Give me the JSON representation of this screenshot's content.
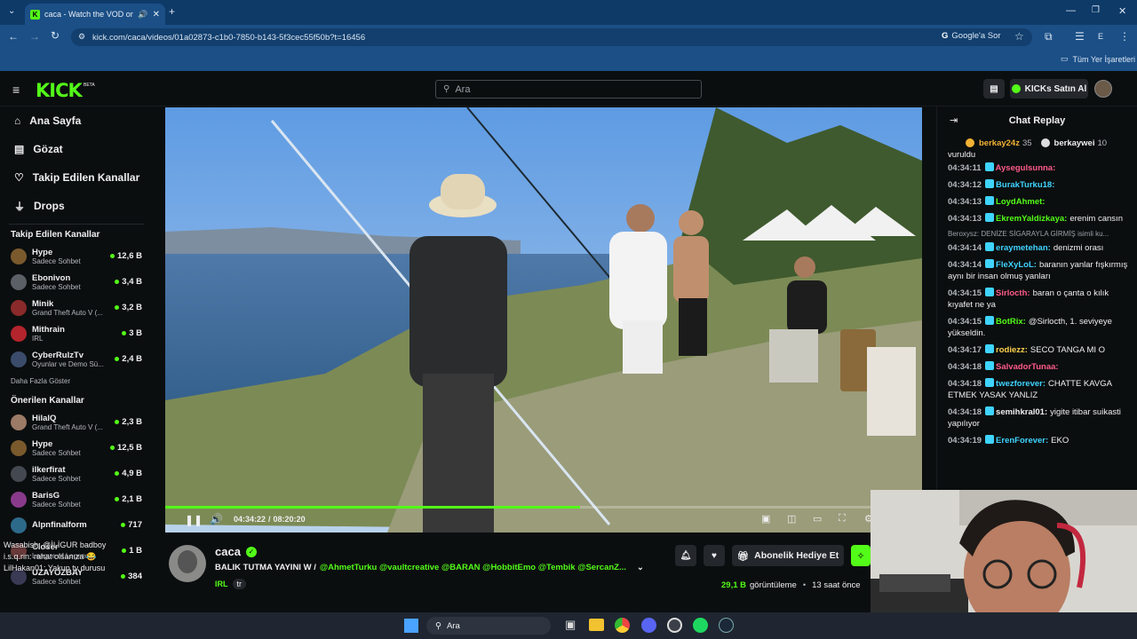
{
  "browser": {
    "tab_title": "caca - Watch the VOD on Kick",
    "url": "kick.com/caca/videos/01a02873-c1b0-7850-b143-5f3cec55f50b?t=16456",
    "google_btn": "Google'a Sor",
    "bookmarks_label": "Tüm Yer İşaretleri",
    "profile_letter": "E"
  },
  "header": {
    "logo": "KICK",
    "logo_beta": "BETA",
    "search_placeholder": "Ara",
    "buy_kicks": "KICKs Satın Al"
  },
  "sidebar": {
    "nav": [
      {
        "label": "Ana Sayfa",
        "icon": "home-icon"
      },
      {
        "label": "Gözat",
        "icon": "browse-icon"
      },
      {
        "label": "Takip Edilen Kanallar",
        "icon": "heart-icon"
      },
      {
        "label": "Drops",
        "icon": "drops-icon"
      }
    ],
    "followed_title": "Takip Edilen Kanallar",
    "followed": [
      {
        "name": "Hype",
        "category": "Sadece Sohbet",
        "viewers": "12,6 B",
        "color": "#7a5a2c"
      },
      {
        "name": "Ebonivon",
        "category": "Sadece Sohbet",
        "viewers": "3,4 B",
        "color": "#5b5f66"
      },
      {
        "name": "Minik",
        "category": "Grand Theft Auto V (...",
        "viewers": "3,2 B",
        "color": "#8a2a2a"
      },
      {
        "name": "Mithrain",
        "category": "IRL",
        "viewers": "3 B",
        "color": "#b3242c"
      },
      {
        "name": "CyberRulzTv",
        "category": "Oyunlar ve Demo Sü...",
        "viewers": "2,4 B",
        "color": "#3a4c6a"
      }
    ],
    "show_more": "Daha Fazla Göster",
    "recommended_title": "Önerilen Kanallar",
    "recommended": [
      {
        "name": "HilalQ",
        "category": "Grand Theft Auto V (...",
        "viewers": "2,3 B",
        "color": "#9b7a66"
      },
      {
        "name": "Hype",
        "category": "Sadece Sohbet",
        "viewers": "12,5 B",
        "color": "#7a5a2c"
      },
      {
        "name": "ilkerfirat",
        "category": "Sadece Sohbet",
        "viewers": "4,9 B",
        "color": "#444850"
      },
      {
        "name": "BarisG",
        "category": "Sadece Sohbet",
        "viewers": "2,1 B",
        "color": "#8a3a8a"
      },
      {
        "name": "Alpnfinalform",
        "category": "",
        "viewers": "717",
        "color": "#2d6a8a"
      },
      {
        "name": "Closer",
        "category": "League of Legends",
        "viewers": "1 B",
        "color": "#6a3a3a"
      },
      {
        "name": "UZAYOZBAY",
        "category": "Sadece Sohbet",
        "viewers": "384",
        "color": "#3a3a55"
      }
    ],
    "overlay_lines": [
      "Wasabish: @İLİGUR badboy",
      "i.s.q.rin: rahat olsanıza 😂",
      "LilHakan01: Yakup tv durusu"
    ]
  },
  "player": {
    "time_current": "04:34:22",
    "time_total": "08:20:20",
    "progress": 0.548
  },
  "stream": {
    "channel": "caca",
    "title": "BALIK TUTMA YAYINI W /",
    "mentions": "@AhmetTurku @vaultcreative @BARAN @HobbitEmo @Tembik @SercanZ...",
    "tag_category": "IRL",
    "tag_lang": "tr",
    "gift_btn": "Abonelik Hediye Et",
    "views": "29,1 B",
    "views_label": "görüntüleme",
    "ago": "13 saat önce"
  },
  "chat": {
    "title": "Chat Replay",
    "top_gifters": [
      {
        "name": "berkay24z",
        "count": "35"
      },
      {
        "name": "berkaywei",
        "count": "10"
      }
    ],
    "partial_top": "vuruldu",
    "reply_line": "Beroxysz: DENİZE SİGARAYLA GİRMİŞ isimli ku...",
    "messages": [
      {
        "t": "04:34:11",
        "u": "Aysegulsunna:",
        "c": "#ff5a8a",
        "m": ""
      },
      {
        "t": "04:34:12",
        "u": "BurakTurku18:",
        "c": "#3fd4ff",
        "m": ""
      },
      {
        "t": "04:34:13",
        "u": "LoydAhmet:",
        "c": "#53fc18",
        "m": ""
      },
      {
        "t": "04:34:13",
        "u": "EkremYaldizkaya:",
        "c": "#53fc18",
        "m": "erenim cansın"
      },
      {
        "t": "04:34:14",
        "u": "eraymetehan:",
        "c": "#3fd4ff",
        "m": "denizmi orası"
      },
      {
        "t": "04:34:14",
        "u": "FleXyLoL:",
        "c": "#3fd4ff",
        "m": "baranın yanlar fışkırmış aynı bir insan olmuş yanları"
      },
      {
        "t": "04:34:15",
        "u": "Sirlocth:",
        "c": "#ff5a8a",
        "m": "baran o çanta o kılık kıyafet ne ya"
      },
      {
        "t": "04:34:15",
        "u": "BotRix:",
        "c": "#53fc18",
        "m": "@Sirlocth, 1. seviyeye yükseldin."
      },
      {
        "t": "04:34:17",
        "u": "rodiezz:",
        "c": "#ffd34d",
        "m": "SECO TANGA MI O"
      },
      {
        "t": "04:34:18",
        "u": "SalvadorTunaa:",
        "c": "#ff5a8a",
        "m": ""
      },
      {
        "t": "04:34:18",
        "u": "twezforever:",
        "c": "#3fd4ff",
        "m": "CHATTE KAVGA ETMEK YASAK YANLIZ"
      },
      {
        "t": "04:34:18",
        "u": "semihkral01:",
        "c": "#efeff1",
        "m": "yigite itibar suikasti yapılıyor"
      },
      {
        "t": "04:34:19",
        "u": "ErenForever:",
        "c": "#3fd4ff",
        "m": "EKO"
      }
    ]
  },
  "taskbar": {
    "search": "Ara"
  }
}
